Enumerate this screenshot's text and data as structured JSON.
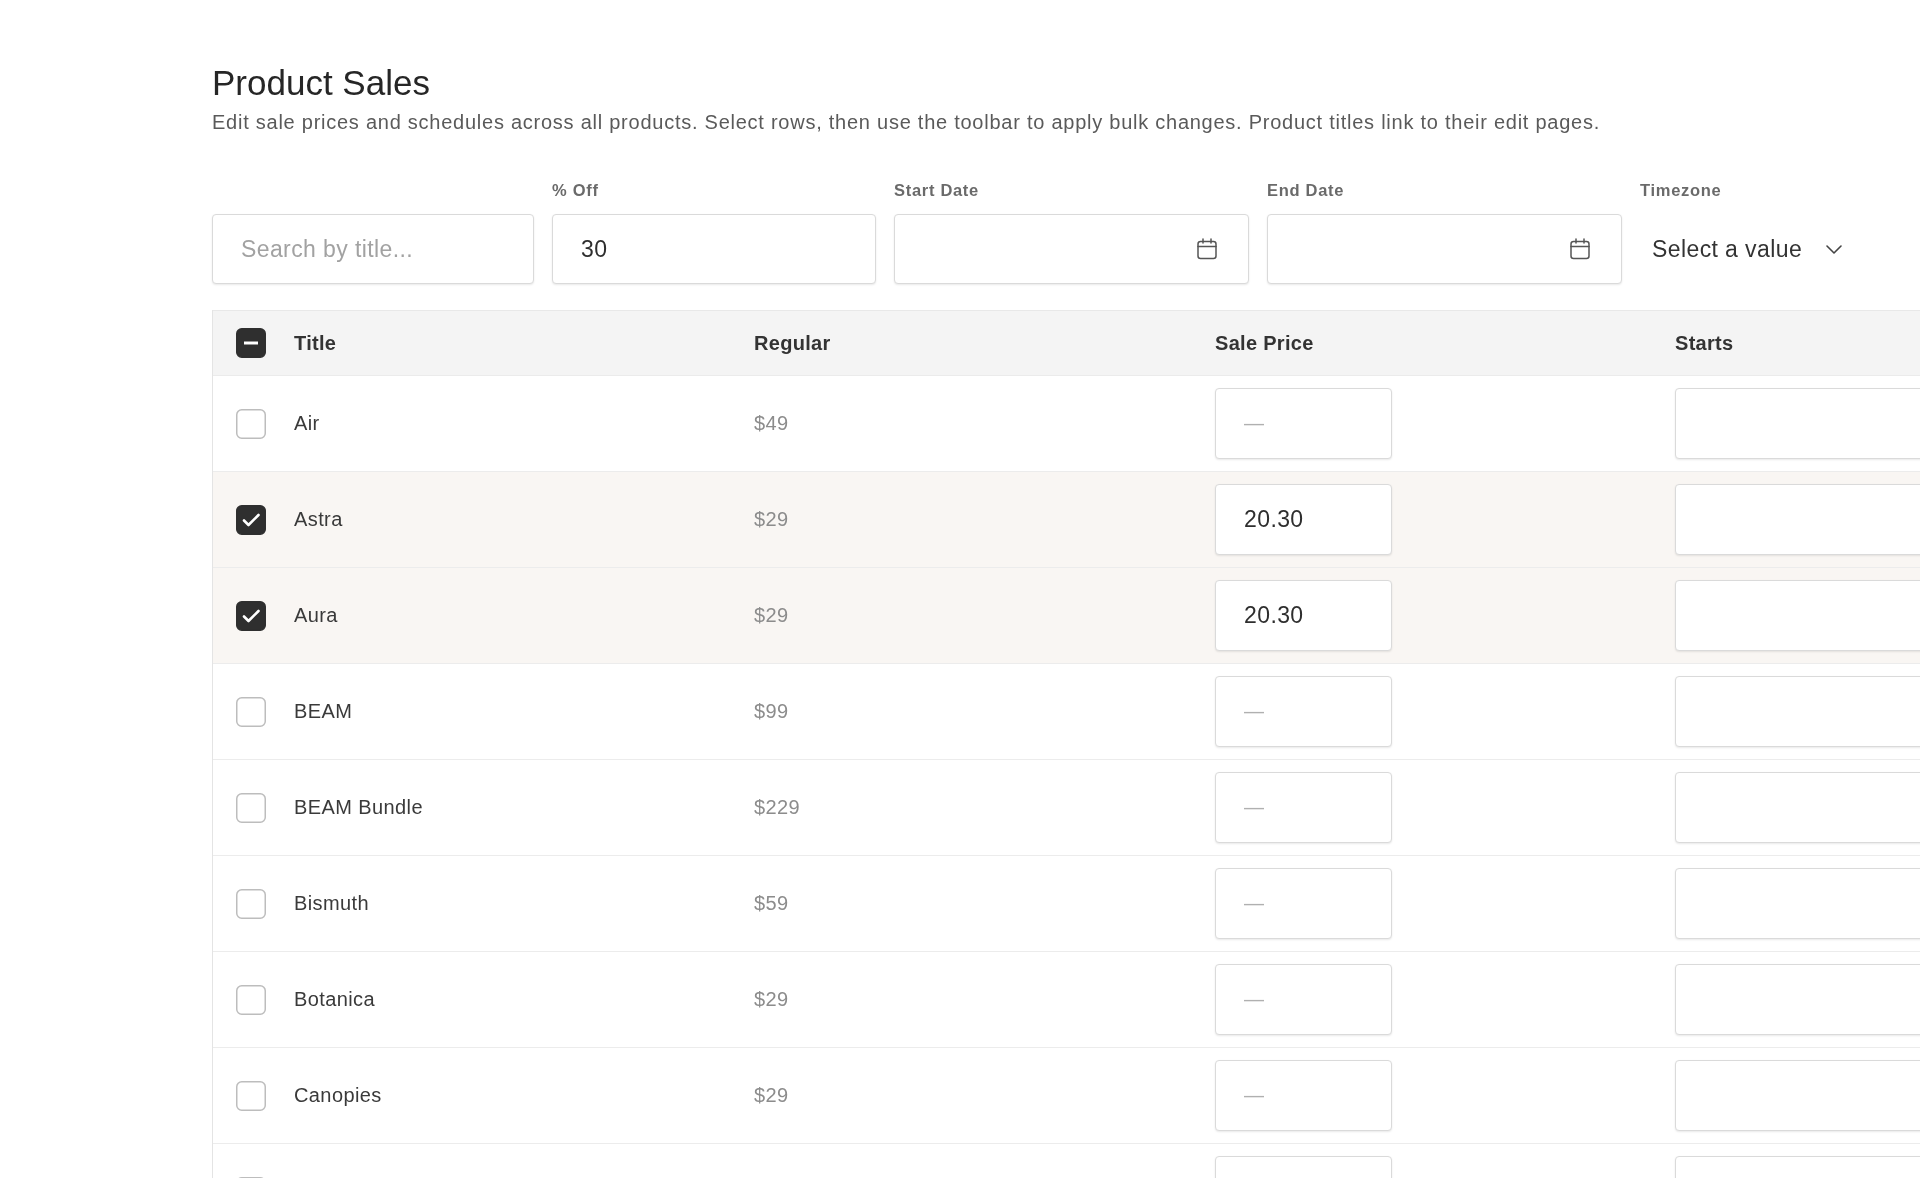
{
  "page": {
    "title": "Product Sales",
    "description": "Edit sale prices and schedules across all products. Select rows, then use the toolbar to apply bulk changes. Product titles link to their edit pages."
  },
  "filters": [
    {
      "kind": "search",
      "placeholder": "Search by title..."
    },
    {
      "kind": "number",
      "label": "% Off",
      "value": "30"
    },
    {
      "kind": "date",
      "label": "Start Date"
    },
    {
      "kind": "date",
      "label": "End Date"
    },
    {
      "kind": "select",
      "label": "Timezone",
      "value": "Select a value"
    }
  ],
  "table": {
    "select_all": {
      "indeterminate": true
    },
    "columns": [
      "Title",
      "Regular",
      "Sale Price",
      "Starts"
    ],
    "rows": [
      {
        "title": "Air",
        "regular": "$49",
        "checked": false,
        "sale_placeholder": "—"
      },
      {
        "title": "Astra",
        "regular": "$29",
        "checked": true,
        "sale_price": "20.30"
      },
      {
        "title": "Aura",
        "regular": "$29",
        "checked": true,
        "sale_price": "20.30"
      },
      {
        "title": "BEAM",
        "regular": "$99",
        "checked": false,
        "sale_placeholder": "—"
      },
      {
        "title": "BEAM Bundle",
        "regular": "$229",
        "checked": false,
        "sale_placeholder": "—"
      },
      {
        "title": "Bismuth",
        "regular": "$59",
        "checked": false,
        "sale_placeholder": "—"
      },
      {
        "title": "Botanica",
        "regular": "$29",
        "checked": false,
        "sale_placeholder": "—"
      },
      {
        "title": "Canopies",
        "regular": "$29",
        "checked": false,
        "sale_placeholder": "—"
      },
      {
        "checked": false
      }
    ]
  }
}
